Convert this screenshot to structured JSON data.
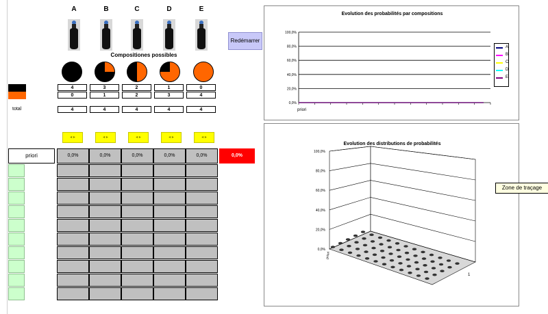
{
  "columns": [
    "A",
    "B",
    "C",
    "D",
    "E"
  ],
  "subtitle": "Compositiones possibles",
  "restart_label": "Redémarrer",
  "rows": {
    "black_counts": [
      "4",
      "3",
      "2",
      "1",
      "0"
    ],
    "orange_counts": [
      "0",
      "1",
      "2",
      "3",
      "4"
    ],
    "totals": [
      "4",
      "4",
      "4",
      "4",
      "4"
    ]
  },
  "total_label": "total",
  "yellow_buttons": [
    "◂ ▸",
    "◂ ▸",
    "◂ ▸",
    "◂ ▸",
    "◂ ▸"
  ],
  "prior_label": "priori",
  "prior_values": [
    "0,0%",
    "0,0%",
    "0,0%",
    "0,0%",
    "0,0%"
  ],
  "red_value": "0,0%",
  "colors": {
    "black": "#000000",
    "orange": "#ff6600",
    "yellow": "#ffff00",
    "red": "#ff0000",
    "green": "#ccffcc",
    "grey": "#c0c0c0"
  },
  "pies": [
    0,
    25,
    50,
    75,
    100
  ],
  "chart_data": [
    {
      "type": "line",
      "title": "Evolution des probabilités par compositions",
      "categories": [
        "priori"
      ],
      "ylim": [
        0,
        100
      ],
      "yticks": [
        "100,0%",
        "80,0%",
        "60,0%",
        "40,0%",
        "20,0%",
        "0,0%"
      ],
      "series": [
        {
          "name": "A",
          "color": "#000080",
          "values": [
            0
          ]
        },
        {
          "name": "B",
          "color": "#ff00ff",
          "values": [
            0
          ]
        },
        {
          "name": "C",
          "color": "#ffff00",
          "values": [
            0
          ]
        },
        {
          "name": "D",
          "color": "#00ffff",
          "values": [
            0
          ]
        },
        {
          "name": "E",
          "color": "#800080",
          "values": [
            0
          ]
        }
      ],
      "legend": "right",
      "grid": true
    },
    {
      "type": "bar",
      "title": "Evolution des distributions de probabilités",
      "yticks": [
        "100,0%",
        "80,0%",
        "60,0%",
        "40,0%",
        "20,0%",
        "0,0%"
      ],
      "ylim": [
        0,
        100
      ],
      "xlabel": "priori",
      "depth_label": "1",
      "values": [
        0
      ]
    }
  ],
  "tooltip": "Zone de traçage"
}
